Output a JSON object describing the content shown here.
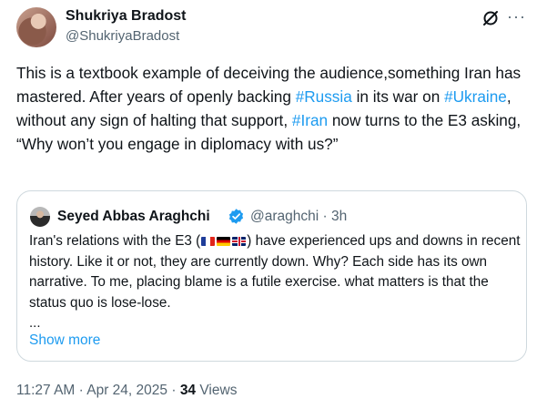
{
  "author": {
    "name": "Shukriya Bradost",
    "handle": "@ShukriyaBradost"
  },
  "header_icons": [
    "grok-icon",
    "more-icon"
  ],
  "more_glyph": "···",
  "tweet": {
    "segments": [
      {
        "text": "This is a textbook example of deceiving the audience,something Iran has mastered. After years of openly backing ",
        "link": false
      },
      {
        "text": "#Russia",
        "link": true
      },
      {
        "text": " in its war on ",
        "link": false
      },
      {
        "text": "#Ukraine",
        "link": true
      },
      {
        "text": ", without any sign of halting that support, ",
        "link": false
      },
      {
        "text": "#Iran",
        "link": true
      },
      {
        "text": " now turns to the E3 asking, “Why won’t you engage in diplomacy with us?”",
        "link": false
      }
    ]
  },
  "quote": {
    "name": "Seyed Abbas Araghchi",
    "handle": "@araghchi",
    "time": "· 3h",
    "text_before_flags": "Iran's relations with the E3 (",
    "flags": [
      "flag-fr",
      "flag-de",
      "flag-uk"
    ],
    "text_after_flags": ") have experienced ups and downs in recent history. Like it or not, they are currently down. Why? Each side has its own narrative. To me, placing blame is a futile exercise. what matters is that the status quo is lose-lose.",
    "ellipsis": "...",
    "show_more": "Show more"
  },
  "meta": {
    "timestamp": "11:27 AM · Apr 24, 2025 ·",
    "views_count": "34",
    "views_label": "Views"
  },
  "colors": {
    "link": "#1d9bf0",
    "secondary_text": "#536471",
    "primary_text": "#0f1419",
    "border": "#cfd9de"
  }
}
